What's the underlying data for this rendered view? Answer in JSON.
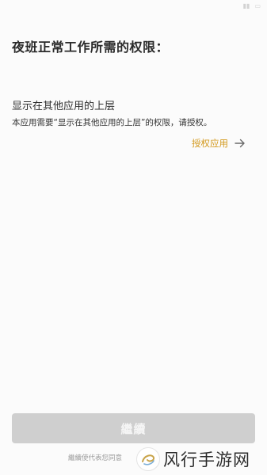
{
  "header": {
    "title": "夜班正常工作所需的权限："
  },
  "permission": {
    "name": "显示在其他应用的上层",
    "description": "本应用需要“显示在其他应用的上层”的权限，请授权。",
    "action_label": "授权应用",
    "action_icon": "arrow-right-icon"
  },
  "footer": {
    "continue_label": "繼續",
    "note": "繼續使代表您同意"
  },
  "watermark": {
    "text": "风行手游网"
  },
  "colors": {
    "accent": "#d39a1f",
    "button_disabled": "#cfcfcf",
    "background": "#fbfbfb"
  }
}
